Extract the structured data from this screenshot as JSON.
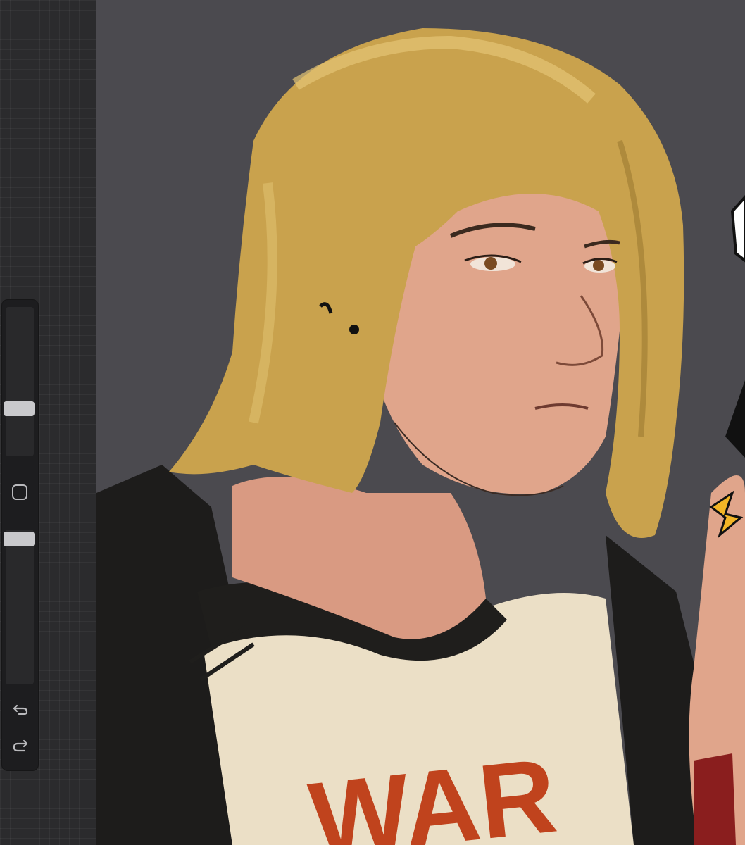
{
  "app": {
    "theme": {
      "workspace": "#4b4a4f",
      "sidebar": "#1d1d1f",
      "slider_thumb": "#c9c9cc",
      "icon": "#b9b9bc"
    }
  },
  "sidebar": {
    "brush_size": {
      "level": 0.52
    },
    "modify_button": {
      "icon": "square-icon"
    },
    "opacity": {
      "level": 0.88
    },
    "undo": {
      "icon": "undo-icon"
    },
    "redo": {
      "icon": "redo-icon"
    }
  },
  "artwork": {
    "shirt_text": "WAR"
  }
}
